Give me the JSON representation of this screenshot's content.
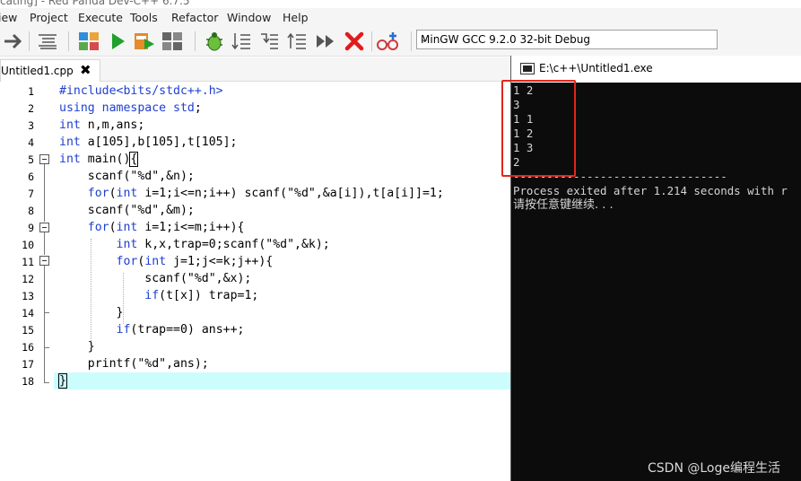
{
  "window_title": "cating] - Red Panda Dev-C++ 6.7.5",
  "menu": [
    {
      "label": "iew"
    },
    {
      "label": "Project"
    },
    {
      "label": "Execute"
    },
    {
      "label": "Tools"
    },
    {
      "label": "Refactor"
    },
    {
      "label": "Window"
    },
    {
      "label": "Help"
    }
  ],
  "toolbar": {
    "compiler": "MinGW GCC 9.2.0 32-bit Debug"
  },
  "tab": {
    "label": "Untitled1.cpp",
    "close": "✖"
  },
  "editor": {
    "line_numbers": [
      "1",
      "2",
      "3",
      "4",
      "5",
      "6",
      "7",
      "8",
      "9",
      "10",
      "11",
      "12",
      "13",
      "14",
      "15",
      "16",
      "17",
      "18"
    ],
    "current_line": 18
  },
  "console": {
    "title": "E:\\c++\\Untitled1.exe",
    "lines": [
      "1 2",
      "3",
      "1 1",
      "1 2",
      "1 3",
      "2"
    ],
    "separator": "--------------------------------",
    "exit_message": "Process exited after 1.214 seconds with r",
    "continue_prompt": "请按任意键继续. . ."
  },
  "watermark": "CSDN @Loge编程生活",
  "colors": {
    "keyword": "#1f3fcf",
    "highlight": "#ccfdfd",
    "annotation_box": "#e0261c",
    "console_bg": "#0c0c0c"
  }
}
